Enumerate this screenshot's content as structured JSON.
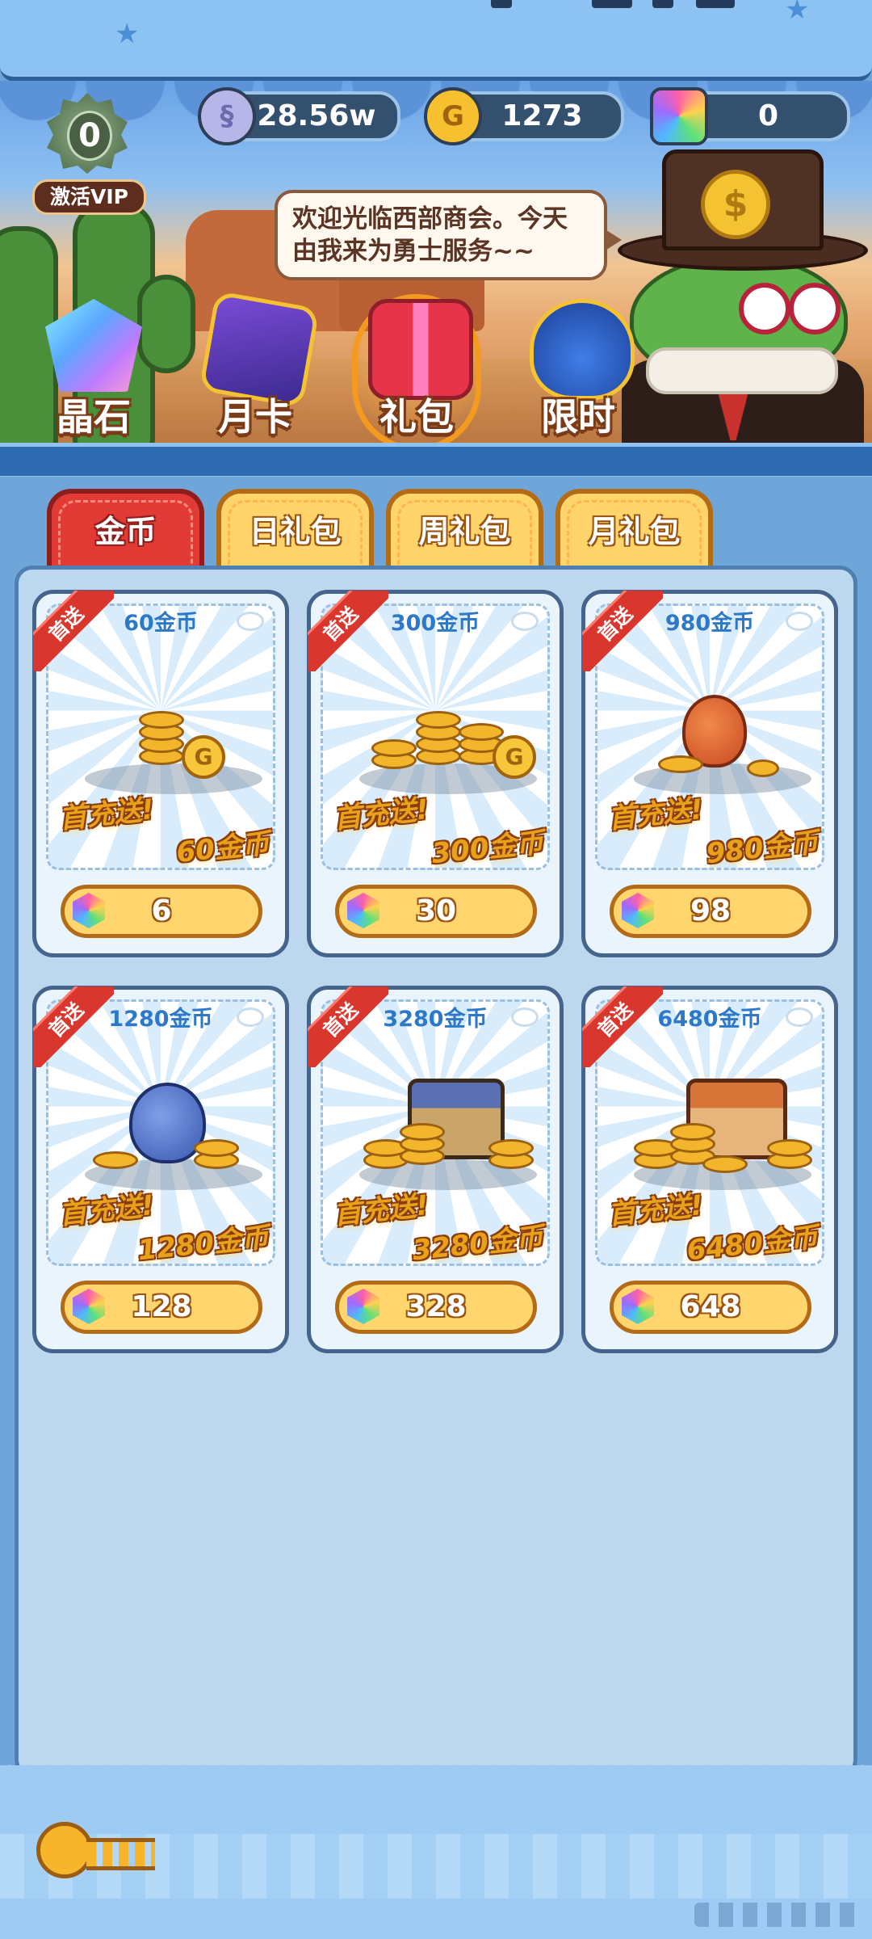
{
  "currencies": {
    "silver": {
      "icon": "silver-coin-icon",
      "value": "28.56w"
    },
    "gold": {
      "icon": "gold-coin-icon",
      "value": "1273"
    },
    "gem": {
      "icon": "gem-icon",
      "value": "0"
    }
  },
  "vip": {
    "level": "0",
    "label": "激活VIP"
  },
  "speech": {
    "text": "欢迎光临西部商会。今天由我来为勇士服务~~"
  },
  "categories": [
    {
      "label": "晶石",
      "icon": "crystal-icon"
    },
    {
      "label": "月卡",
      "icon": "month-card-icon"
    },
    {
      "label": "礼包",
      "icon": "gift-box-icon"
    },
    {
      "label": "限时",
      "icon": "limited-bag-icon"
    }
  ],
  "active_category": "礼包",
  "sub_tabs": [
    {
      "label": "金币"
    },
    {
      "label": "日礼包"
    },
    {
      "label": "周礼包"
    },
    {
      "label": "月礼包"
    }
  ],
  "active_sub_tab": "金币",
  "products": [
    {
      "title": "60金币",
      "ribbon": "首送",
      "promo_line1": "首充送!",
      "promo_line2": "60金币",
      "price": "6"
    },
    {
      "title": "300金币",
      "ribbon": "首送",
      "promo_line1": "首充送!",
      "promo_line2": "300金币",
      "price": "30"
    },
    {
      "title": "980金币",
      "ribbon": "首送",
      "promo_line1": "首充送!",
      "promo_line2": "980金币",
      "price": "98"
    },
    {
      "title": "1280金币",
      "ribbon": "首送",
      "promo_line1": "首充送!",
      "promo_line2": "1280金币",
      "price": "128"
    },
    {
      "title": "3280金币",
      "ribbon": "首送",
      "promo_line1": "首充送!",
      "promo_line2": "3280金币",
      "price": "328"
    },
    {
      "title": "6480金币",
      "ribbon": "首送",
      "promo_line1": "首充送!",
      "promo_line2": "6480金币",
      "price": "648"
    }
  ],
  "colors": {
    "accent_red": "#e23b35",
    "tab_yellow": "#ffd56b",
    "title_blue": "#2e78c8",
    "panel_bg": "#bcd7ee"
  }
}
